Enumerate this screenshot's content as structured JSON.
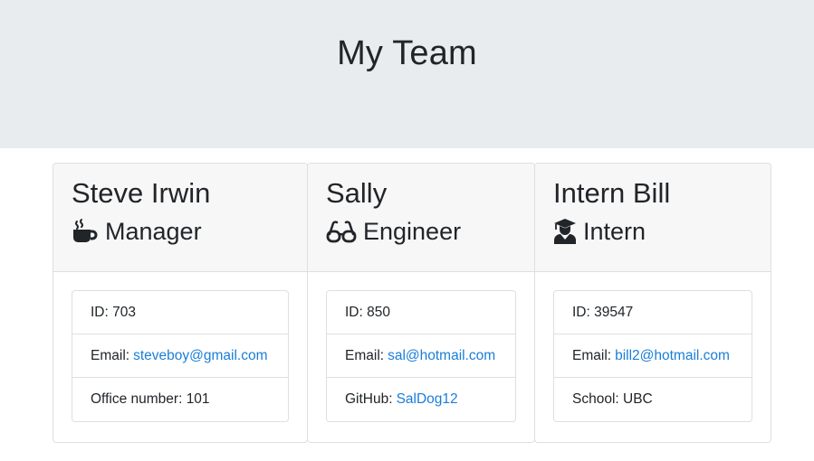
{
  "header": {
    "title": "My Team"
  },
  "employees": [
    {
      "name": "Steve Irwin",
      "role": "Manager",
      "icon": "coffee-mug-icon",
      "id_label": "ID:",
      "id": "703",
      "email_label": "Email:",
      "email": "steveboy@gmail.com",
      "extra_label": "Office number:",
      "extra": "101"
    },
    {
      "name": "Sally",
      "role": "Engineer",
      "icon": "glasses-icon",
      "id_label": "ID:",
      "id": "850",
      "email_label": "Email:",
      "email": "sal@hotmail.com",
      "extra_label": "GitHub:",
      "extra": "SalDog12"
    },
    {
      "name": "Intern Bill",
      "role": "Intern",
      "icon": "graduate-icon",
      "id_label": "ID:",
      "id": "39547",
      "email_label": "Email:",
      "email": "bill2@hotmail.com",
      "extra_label": "School:",
      "extra": "UBC"
    }
  ],
  "colors": {
    "link": "#1a7ed8",
    "jumbotron": "#e9ecef",
    "card_header": "#f7f7f7"
  }
}
